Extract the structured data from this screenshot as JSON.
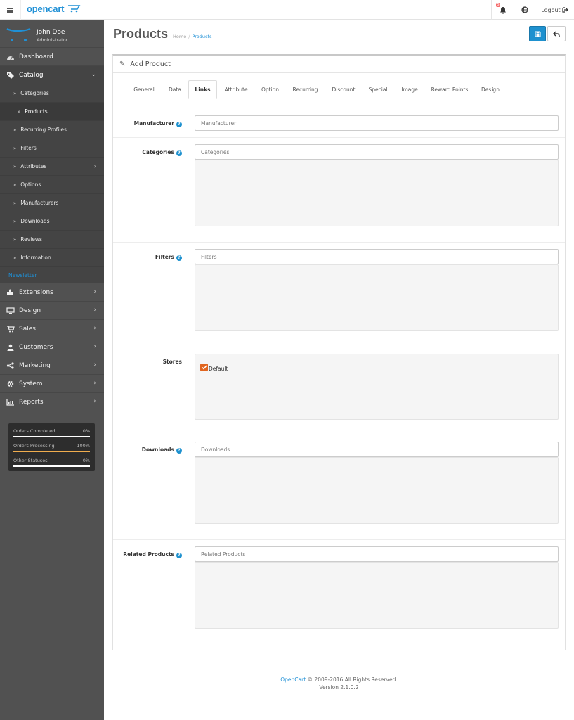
{
  "header": {
    "logo_text": "opencart",
    "notification_count": "5",
    "logout_label": "Logout"
  },
  "profile": {
    "name": "John Doe",
    "role": "Administrator"
  },
  "nav": {
    "dashboard": "Dashboard",
    "catalog": "Catalog",
    "catalog_items": [
      "Categories",
      "Products",
      "Recurring Profiles",
      "Filters",
      "Attributes",
      "Options",
      "Manufacturers",
      "Downloads",
      "Reviews",
      "Information"
    ],
    "newsletter": "Newsletter",
    "extensions": "Extensions",
    "design": "Design",
    "sales": "Sales",
    "customers": "Customers",
    "marketing": "Marketing",
    "system": "System",
    "reports": "Reports"
  },
  "stats": [
    {
      "label": "Orders Completed",
      "value": "0%",
      "fraction": 0,
      "color": "#ffffff"
    },
    {
      "label": "Orders Processing",
      "value": "100%",
      "fraction": 1,
      "color": "#f0ad4e"
    },
    {
      "label": "Other Statuses",
      "value": "0%",
      "fraction": 0,
      "color": "#ffffff"
    }
  ],
  "page": {
    "title": "Products",
    "breadcrumb": [
      "Home",
      "Products"
    ],
    "panel_title": "Add Product"
  },
  "tabs": [
    "General",
    "Data",
    "Links",
    "Attribute",
    "Option",
    "Recurring",
    "Discount",
    "Special",
    "Image",
    "Reward Points",
    "Design"
  ],
  "form": {
    "manufacturer": {
      "label": "Manufacturer",
      "placeholder": "Manufacturer"
    },
    "categories": {
      "label": "Categories",
      "placeholder": "Categories"
    },
    "filters": {
      "label": "Filters",
      "placeholder": "Filters"
    },
    "stores": {
      "label": "Stores",
      "option": "Default",
      "checked": true
    },
    "downloads": {
      "label": "Downloads",
      "placeholder": "Downloads"
    },
    "related": {
      "label": "Related Products",
      "placeholder": "Related Products"
    }
  },
  "footer": {
    "brand": "OpenCart",
    "copyright": "© 2009-2016 All Rights Reserved.",
    "version": "Version 2.1.0.2"
  },
  "colors": {
    "accent": "#1e91cf",
    "sidebar": "#515151",
    "checkbox": "#e1651f"
  }
}
